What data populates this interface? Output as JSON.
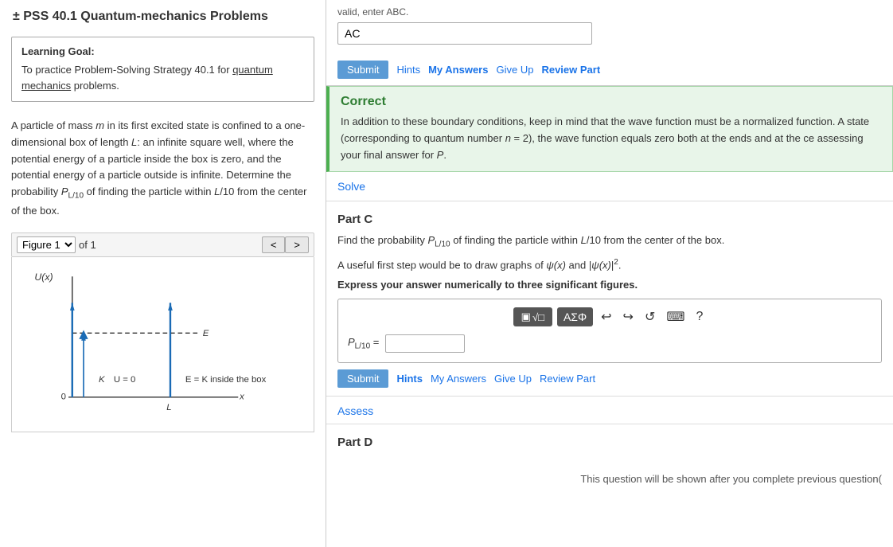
{
  "left": {
    "title": "± PSS 40.1 Quantum-mechanics Problems",
    "learning_goal": {
      "heading": "Learning Goal:",
      "text": "To practice Problem-Solving Strategy 40.1 for quantum mechanics problems.",
      "link_text": "quantum mechanics"
    },
    "problem_text": "A particle of mass m in its first excited state is confined to a one-dimensional box of length L: an infinite square well, where the potential energy of a particle inside the box is zero, and the potential energy of a particle outside is infinite. Determine the probability P_{L/10} of finding the particle within L/10 from the center of the box.",
    "figure": {
      "label": "Figure 1",
      "of": "of 1",
      "prev_label": "<",
      "next_label": ">",
      "caption_labels": {
        "u_x": "U(x)",
        "zero": "0",
        "k_label": "K",
        "u_zero": "U = 0",
        "e_label": "E",
        "e_eq": "E = K inside the box",
        "x_label": "x",
        "l_label": "L"
      }
    }
  },
  "right": {
    "top_input": {
      "value": "AC",
      "hint_text": "valid, enter ABC."
    },
    "top_actions": {
      "submit_label": "Submit",
      "hints_label": "Hints",
      "my_answers_label": "My Answers",
      "give_up_label": "Give Up",
      "review_part_label": "Review Part"
    },
    "correct_box": {
      "title": "Correct",
      "text": "In addition to these boundary conditions, keep in mind that the wave function must be a normalized function. A state (corresponding to quantum number n = 2), the wave function equals zero both at the ends and at the ce assessing your final answer for P."
    },
    "solve_link": "Solve",
    "part_c": {
      "title": "Part C",
      "text1": "Find the probability P_{L/10} of finding the particle within L/10 from the center of the box.",
      "text2": "A useful first step would be to draw graphs of ψ(x) and |ψ(x)|².",
      "instruction": "Express your answer numerically to three significant figures.",
      "toolbar": {
        "matrix_btn": "▣√□",
        "symbol_btn": "ΑΣΦ",
        "undo_icon": "↩",
        "redo_icon": "↪",
        "refresh_icon": "↺",
        "keyboard_icon": "⌨",
        "help_icon": "?"
      },
      "answer_label": "P_{L/10} =",
      "answer_value": "",
      "submit_label": "Submit",
      "hints_label": "Hints",
      "my_answers_label": "My Answers",
      "give_up_label": "Give Up",
      "review_part_label": "Review Part"
    },
    "assess_link": "Assess",
    "part_d": {
      "title": "Part D",
      "message": "This question will be shown after you complete previous question("
    }
  }
}
